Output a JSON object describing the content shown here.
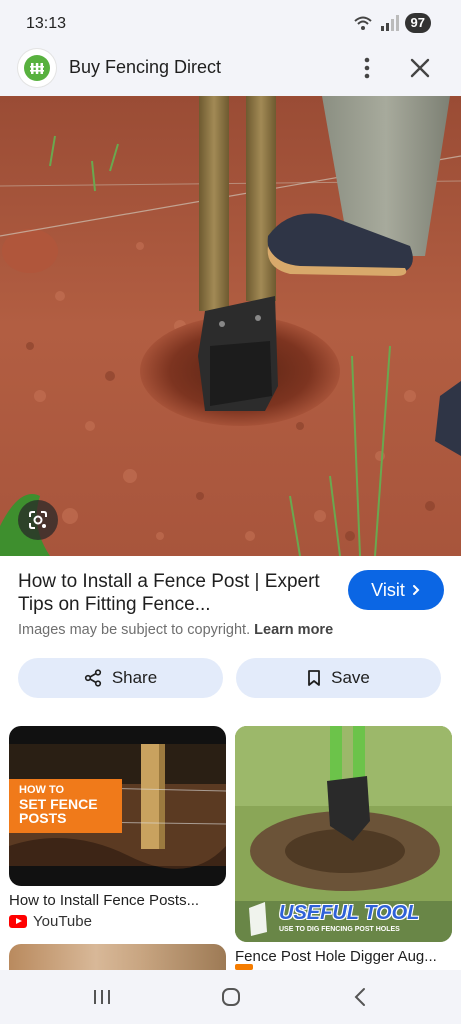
{
  "status_bar": {
    "time": "13:13",
    "battery": "97",
    "icons": [
      "wifi-icon",
      "signal-icon"
    ]
  },
  "header": {
    "site_name": "Buy Fencing Direct",
    "logo_icon": "fence-logo-icon",
    "menu_icon": "more-vertical-icon",
    "close_icon": "close-icon"
  },
  "hero_image": {
    "lens_icon": "google-lens-icon"
  },
  "result": {
    "title": "How to Install a Fence Post | Expert Tips on Fitting Fence...",
    "visit_label": "Visit",
    "copyright_text": "Images may be subject to copyright.",
    "learn_more": "Learn more",
    "share_label": "Share",
    "save_label": "Save"
  },
  "related": [
    {
      "title": "How to Install Fence Posts...",
      "source": "YouTube",
      "overlay_line1": "HOW TO",
      "overlay_line2": "SET FENCE",
      "overlay_line3": "POSTS"
    },
    {
      "title": "Fence Post Hole Digger Aug...",
      "overlay_title": "USEFUL TOOL",
      "overlay_subtitle": "USE TO DIG FENCING POST HOLES"
    }
  ],
  "colors": {
    "accent": "#0b66e4",
    "pill_bg": "#e3ebfa",
    "youtube_red": "#ff0000",
    "overlay_orange": "#f07a1a"
  },
  "nav": {
    "icons": [
      "recents-icon",
      "home-icon",
      "back-icon"
    ]
  }
}
